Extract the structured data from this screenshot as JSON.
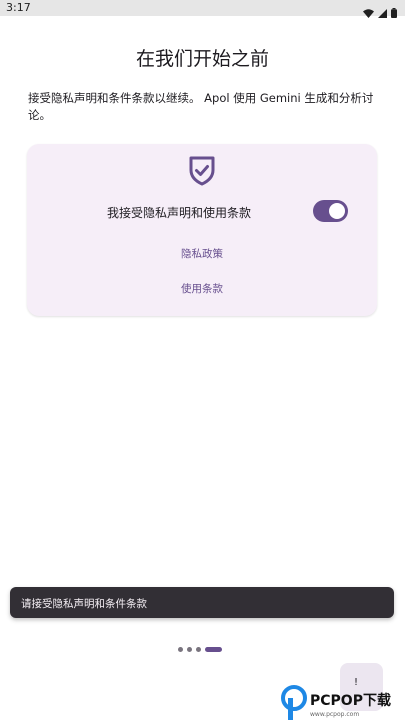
{
  "status_bar": {
    "time": "3:17"
  },
  "title": "在我们开始之前",
  "intro": "接受隐私声明和条件条款以继续。 Apol 使用 Gemini 生成和分析讨论。",
  "card": {
    "accept_label": "我接受隐私声明和使用条款",
    "toggle_on": true,
    "privacy_link": "隐私政策",
    "terms_link": "使用条款"
  },
  "snackbar": {
    "message": "请接受隐私声明和条件条款"
  },
  "pager": {
    "total": 4,
    "current": 4
  },
  "next_button": {
    "label": "!"
  },
  "watermark": {
    "brand": "PCPOP下载",
    "url": "www.pcpop.com"
  },
  "colors": {
    "accent": "#674f8e",
    "card_bg": "#f6eef8",
    "snackbar_bg": "#322f35"
  }
}
